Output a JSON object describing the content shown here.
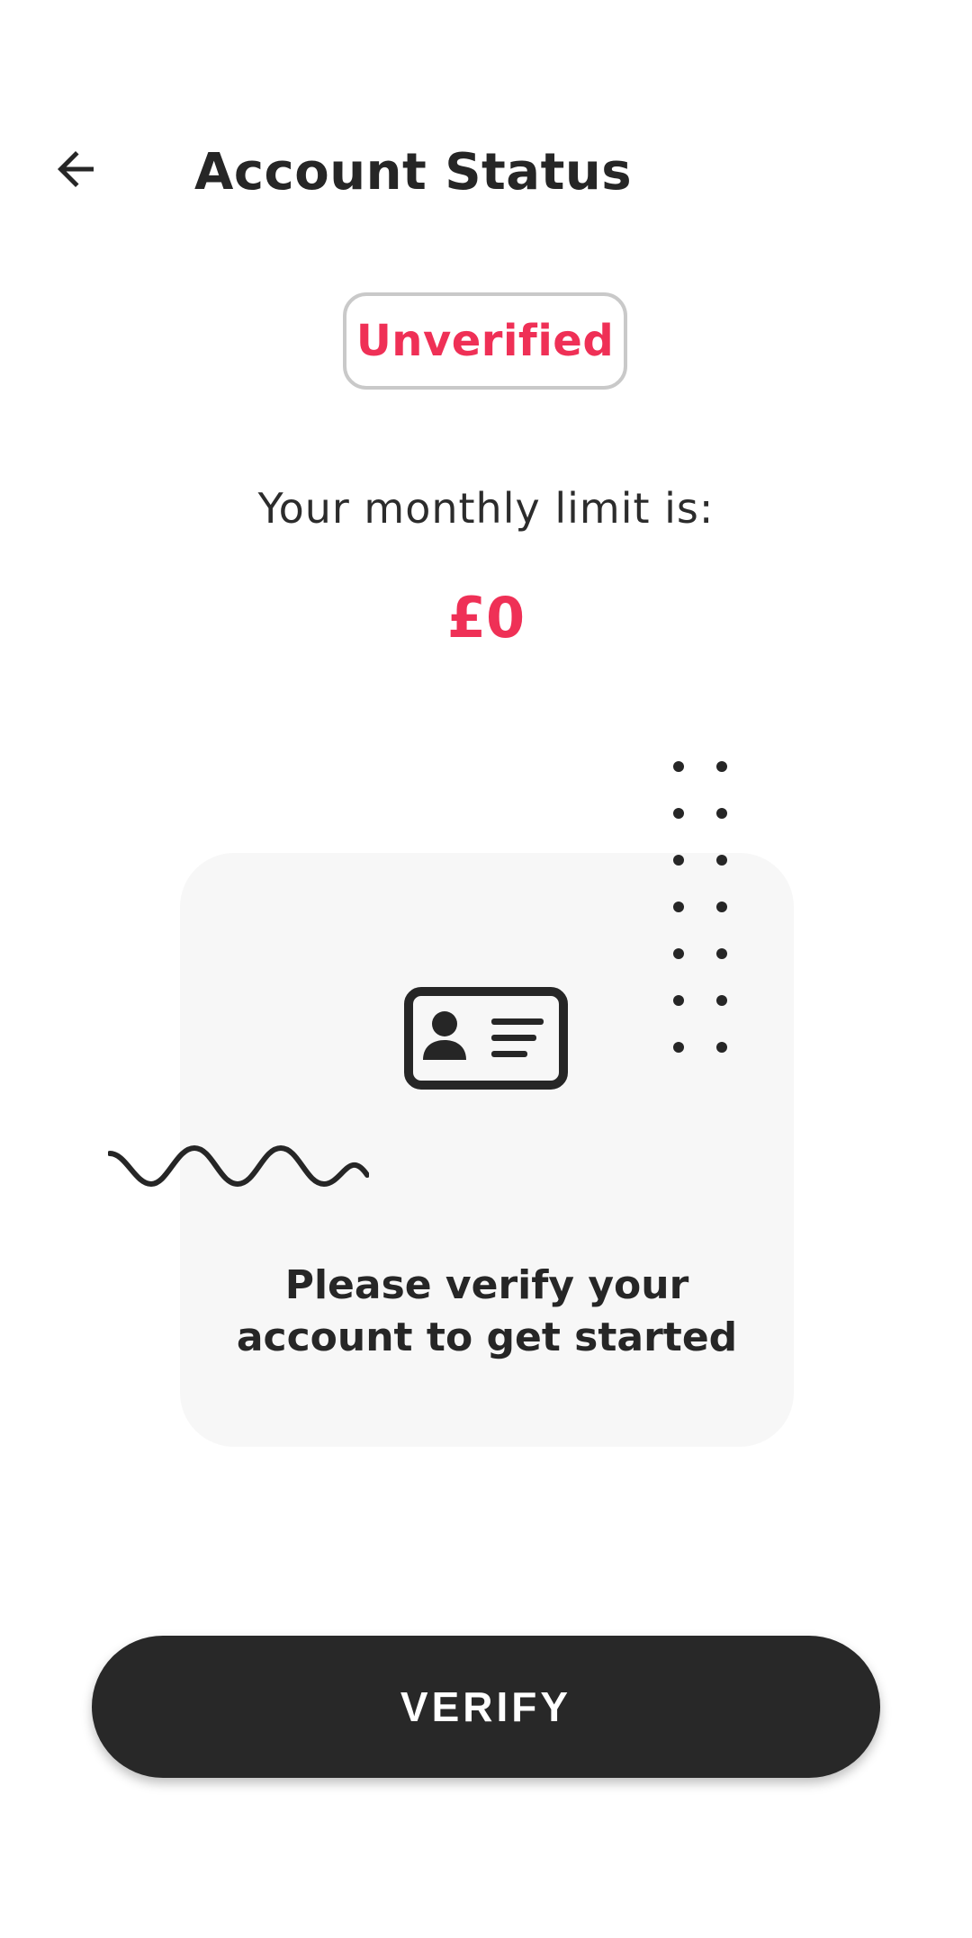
{
  "header": {
    "back_icon": "arrow-left-icon",
    "title": "Account Status"
  },
  "status": {
    "badge_label": "Unverified",
    "badge_color": "#ef3056"
  },
  "limit": {
    "label": "Your monthly limit is:",
    "value": "£0"
  },
  "card": {
    "icon": "id-card-icon",
    "message_line1": "Please verify your",
    "message_line2": "account to get started"
  },
  "actions": {
    "verify_label": "VERIFY"
  },
  "colors": {
    "accent": "#ef3056",
    "button_bg": "#282828",
    "card_bg": "#f7f7f7"
  }
}
